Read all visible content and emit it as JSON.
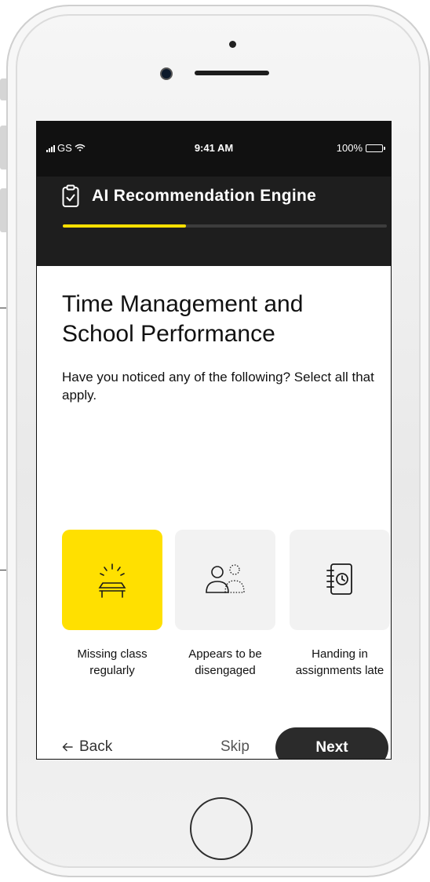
{
  "status_bar": {
    "carrier": "GS",
    "time": "9:41 AM",
    "battery": "100%"
  },
  "app": {
    "title": "AI Recommendation Engine",
    "progress_fraction": 0.38
  },
  "question": {
    "title_line1": "Time Management and",
    "title_line2": "School Performance",
    "prompt": "Have you noticed any of the following? Select all that apply."
  },
  "options": [
    {
      "label": "Missing class regularly",
      "icon": "empty-desk-icon",
      "selected": true
    },
    {
      "label": "Appears to be disengaged",
      "icon": "disengaged-people-icon",
      "selected": false
    },
    {
      "label": "Handing in assignments late",
      "icon": "late-notebook-icon",
      "selected": false
    }
  ],
  "footer": {
    "back_label": "Back",
    "skip_label": "Skip",
    "next_label": "Next"
  },
  "colors": {
    "accent": "#ffe000",
    "header_bg": "#1e1e1e",
    "tile_bg": "#f2f2f2",
    "next_bg": "#2b2b2b"
  }
}
